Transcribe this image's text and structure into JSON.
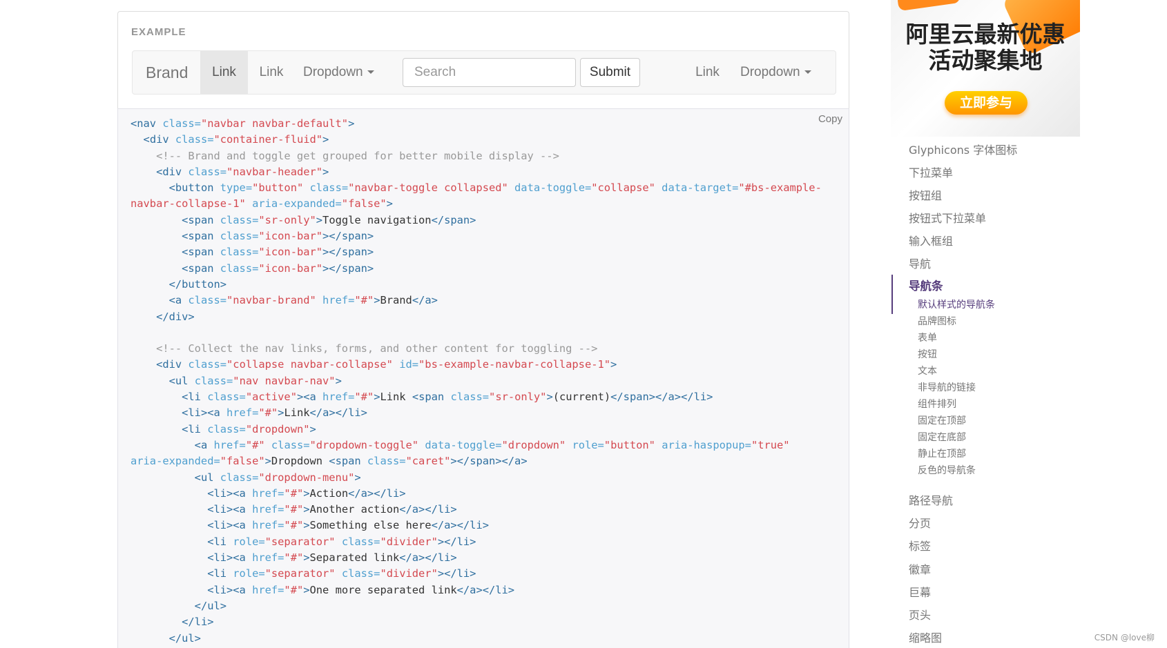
{
  "example": {
    "label": "EXAMPLE",
    "navbar": {
      "brand": "Brand",
      "link_active": "Link",
      "link_2": "Link",
      "dropdown_1": "Dropdown",
      "search_placeholder": "Search",
      "submit": "Submit",
      "link_3": "Link",
      "dropdown_2": "Dropdown"
    }
  },
  "code_block": {
    "copy_label": "Copy",
    "lines": [
      [
        [
          "tg",
          "<nav "
        ],
        [
          "at",
          "class="
        ],
        [
          "vl",
          "\"navbar navbar-default\""
        ],
        [
          "tg",
          ">"
        ]
      ],
      [
        [
          "",
          "  "
        ],
        [
          "tg",
          "<div "
        ],
        [
          "at",
          "class="
        ],
        [
          "vl",
          "\"container-fluid\""
        ],
        [
          "tg",
          ">"
        ]
      ],
      [
        [
          "",
          "    "
        ],
        [
          "cm",
          "<!-- Brand and toggle get grouped for better mobile display -->"
        ]
      ],
      [
        [
          "",
          "    "
        ],
        [
          "tg",
          "<div "
        ],
        [
          "at",
          "class="
        ],
        [
          "vl",
          "\"navbar-header\""
        ],
        [
          "tg",
          ">"
        ]
      ],
      [
        [
          "",
          "      "
        ],
        [
          "tg",
          "<button "
        ],
        [
          "at",
          "type="
        ],
        [
          "vl",
          "\"button\" "
        ],
        [
          "at",
          "class="
        ],
        [
          "vl",
          "\"navbar-toggle collapsed\" "
        ],
        [
          "at",
          "data-toggle="
        ],
        [
          "vl",
          "\"collapse\" "
        ],
        [
          "at",
          "data-target="
        ],
        [
          "vl",
          "\"#bs-example-"
        ]
      ],
      [
        [
          "vl",
          "navbar-collapse-1\" "
        ],
        [
          "at",
          "aria-expanded="
        ],
        [
          "vl",
          "\"false\""
        ],
        [
          "tg",
          ">"
        ]
      ],
      [
        [
          "",
          "        "
        ],
        [
          "tg",
          "<span "
        ],
        [
          "at",
          "class="
        ],
        [
          "vl",
          "\"sr-only\""
        ],
        [
          "tg",
          ">"
        ],
        [
          "",
          "Toggle navigation"
        ],
        [
          "tg",
          "</span>"
        ]
      ],
      [
        [
          "",
          "        "
        ],
        [
          "tg",
          "<span "
        ],
        [
          "at",
          "class="
        ],
        [
          "vl",
          "\"icon-bar\""
        ],
        [
          "tg",
          "></span>"
        ]
      ],
      [
        [
          "",
          "        "
        ],
        [
          "tg",
          "<span "
        ],
        [
          "at",
          "class="
        ],
        [
          "vl",
          "\"icon-bar\""
        ],
        [
          "tg",
          "></span>"
        ]
      ],
      [
        [
          "",
          "        "
        ],
        [
          "tg",
          "<span "
        ],
        [
          "at",
          "class="
        ],
        [
          "vl",
          "\"icon-bar\""
        ],
        [
          "tg",
          "></span>"
        ]
      ],
      [
        [
          "",
          "      "
        ],
        [
          "tg",
          "</button>"
        ]
      ],
      [
        [
          "",
          "      "
        ],
        [
          "tg",
          "<a "
        ],
        [
          "at",
          "class="
        ],
        [
          "vl",
          "\"navbar-brand\" "
        ],
        [
          "at",
          "href="
        ],
        [
          "vl",
          "\"#\""
        ],
        [
          "tg",
          ">"
        ],
        [
          "",
          "Brand"
        ],
        [
          "tg",
          "</a>"
        ]
      ],
      [
        [
          "",
          "    "
        ],
        [
          "tg",
          "</div>"
        ]
      ],
      [
        [
          "",
          ""
        ]
      ],
      [
        [
          "",
          "    "
        ],
        [
          "cm",
          "<!-- Collect the nav links, forms, and other content for toggling -->"
        ]
      ],
      [
        [
          "",
          "    "
        ],
        [
          "tg",
          "<div "
        ],
        [
          "at",
          "class="
        ],
        [
          "vl",
          "\"collapse navbar-collapse\" "
        ],
        [
          "at",
          "id="
        ],
        [
          "vl",
          "\"bs-example-navbar-collapse-1\""
        ],
        [
          "tg",
          ">"
        ]
      ],
      [
        [
          "",
          "      "
        ],
        [
          "tg",
          "<ul "
        ],
        [
          "at",
          "class="
        ],
        [
          "vl",
          "\"nav navbar-nav\""
        ],
        [
          "tg",
          ">"
        ]
      ],
      [
        [
          "",
          "        "
        ],
        [
          "tg",
          "<li "
        ],
        [
          "at",
          "class="
        ],
        [
          "vl",
          "\"active\""
        ],
        [
          "tg",
          "><a "
        ],
        [
          "at",
          "href="
        ],
        [
          "vl",
          "\"#\""
        ],
        [
          "tg",
          ">"
        ],
        [
          "",
          "Link "
        ],
        [
          "tg",
          "<span "
        ],
        [
          "at",
          "class="
        ],
        [
          "vl",
          "\"sr-only\""
        ],
        [
          "tg",
          ">"
        ],
        [
          "",
          "(current)"
        ],
        [
          "tg",
          "</span></a></li>"
        ]
      ],
      [
        [
          "",
          "        "
        ],
        [
          "tg",
          "<li><a "
        ],
        [
          "at",
          "href="
        ],
        [
          "vl",
          "\"#\""
        ],
        [
          "tg",
          ">"
        ],
        [
          "",
          "Link"
        ],
        [
          "tg",
          "</a></li>"
        ]
      ],
      [
        [
          "",
          "        "
        ],
        [
          "tg",
          "<li "
        ],
        [
          "at",
          "class="
        ],
        [
          "vl",
          "\"dropdown\""
        ],
        [
          "tg",
          ">"
        ]
      ],
      [
        [
          "",
          "          "
        ],
        [
          "tg",
          "<a "
        ],
        [
          "at",
          "href="
        ],
        [
          "vl",
          "\"#\" "
        ],
        [
          "at",
          "class="
        ],
        [
          "vl",
          "\"dropdown-toggle\" "
        ],
        [
          "at",
          "data-toggle="
        ],
        [
          "vl",
          "\"dropdown\" "
        ],
        [
          "at",
          "role="
        ],
        [
          "vl",
          "\"button\" "
        ],
        [
          "at",
          "aria-haspopup="
        ],
        [
          "vl",
          "\"true\""
        ]
      ],
      [
        [
          "at",
          "aria-expanded="
        ],
        [
          "vl",
          "\"false\""
        ],
        [
          "tg",
          ">"
        ],
        [
          "",
          "Dropdown "
        ],
        [
          "tg",
          "<span "
        ],
        [
          "at",
          "class="
        ],
        [
          "vl",
          "\"caret\""
        ],
        [
          "tg",
          "></span></a>"
        ]
      ],
      [
        [
          "",
          "          "
        ],
        [
          "tg",
          "<ul "
        ],
        [
          "at",
          "class="
        ],
        [
          "vl",
          "\"dropdown-menu\""
        ],
        [
          "tg",
          ">"
        ]
      ],
      [
        [
          "",
          "            "
        ],
        [
          "tg",
          "<li><a "
        ],
        [
          "at",
          "href="
        ],
        [
          "vl",
          "\"#\""
        ],
        [
          "tg",
          ">"
        ],
        [
          "",
          "Action"
        ],
        [
          "tg",
          "</a></li>"
        ]
      ],
      [
        [
          "",
          "            "
        ],
        [
          "tg",
          "<li><a "
        ],
        [
          "at",
          "href="
        ],
        [
          "vl",
          "\"#\""
        ],
        [
          "tg",
          ">"
        ],
        [
          "",
          "Another action"
        ],
        [
          "tg",
          "</a></li>"
        ]
      ],
      [
        [
          "",
          "            "
        ],
        [
          "tg",
          "<li><a "
        ],
        [
          "at",
          "href="
        ],
        [
          "vl",
          "\"#\""
        ],
        [
          "tg",
          ">"
        ],
        [
          "",
          "Something else here"
        ],
        [
          "tg",
          "</a></li>"
        ]
      ],
      [
        [
          "",
          "            "
        ],
        [
          "tg",
          "<li "
        ],
        [
          "at",
          "role="
        ],
        [
          "vl",
          "\"separator\" "
        ],
        [
          "at",
          "class="
        ],
        [
          "vl",
          "\"divider\""
        ],
        [
          "tg",
          "></li>"
        ]
      ],
      [
        [
          "",
          "            "
        ],
        [
          "tg",
          "<li><a "
        ],
        [
          "at",
          "href="
        ],
        [
          "vl",
          "\"#\""
        ],
        [
          "tg",
          ">"
        ],
        [
          "",
          "Separated link"
        ],
        [
          "tg",
          "</a></li>"
        ]
      ],
      [
        [
          "",
          "            "
        ],
        [
          "tg",
          "<li "
        ],
        [
          "at",
          "role="
        ],
        [
          "vl",
          "\"separator\" "
        ],
        [
          "at",
          "class="
        ],
        [
          "vl",
          "\"divider\""
        ],
        [
          "tg",
          "></li>"
        ]
      ],
      [
        [
          "",
          "            "
        ],
        [
          "tg",
          "<li><a "
        ],
        [
          "at",
          "href="
        ],
        [
          "vl",
          "\"#\""
        ],
        [
          "tg",
          ">"
        ],
        [
          "",
          "One more separated link"
        ],
        [
          "tg",
          "</a></li>"
        ]
      ],
      [
        [
          "",
          "          "
        ],
        [
          "tg",
          "</ul>"
        ]
      ],
      [
        [
          "",
          "        "
        ],
        [
          "tg",
          "</li>"
        ]
      ],
      [
        [
          "",
          "      "
        ],
        [
          "tg",
          "</ul>"
        ]
      ]
    ]
  },
  "ad": {
    "title_line1": "阿里云最新优惠",
    "title_line2": "活动聚集地",
    "button": "立即参与"
  },
  "sidebar": {
    "items": [
      "Glyphicons 字体图标",
      "下拉菜单",
      "按钮组",
      "按钮式下拉菜单",
      "输入框组",
      "导航",
      "导航条",
      "路径导航",
      "分页",
      "标签",
      "徽章",
      "巨幕",
      "页头",
      "缩略图"
    ],
    "active_item": "导航条",
    "sub_items": [
      "默认样式的导航条",
      "品牌图标",
      "表单",
      "按钮",
      "文本",
      "非导航的链接",
      "组件排列",
      "固定在顶部",
      "固定在底部",
      "静止在顶部",
      "反色的导航条"
    ],
    "active_sub_item": "默认样式的导航条"
  },
  "watermark": "CSDN @love柳"
}
